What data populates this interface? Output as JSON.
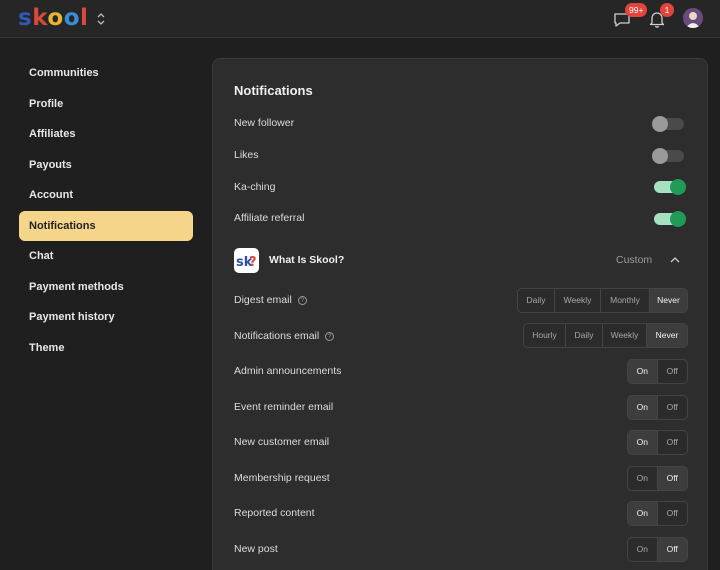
{
  "topbar": {
    "logo_parts": [
      "s",
      "k",
      "o",
      "o",
      "l"
    ],
    "chat_badge": "99+",
    "bell_badge": "1"
  },
  "sidebar": {
    "items": [
      {
        "label": "Communities"
      },
      {
        "label": "Profile"
      },
      {
        "label": "Affiliates"
      },
      {
        "label": "Payouts"
      },
      {
        "label": "Account"
      },
      {
        "label": "Notifications",
        "active": true
      },
      {
        "label": "Chat"
      },
      {
        "label": "Payment methods"
      },
      {
        "label": "Payment history"
      },
      {
        "label": "Theme"
      }
    ]
  },
  "notifications": {
    "title": "Notifications",
    "toggles": [
      {
        "label": "New follower",
        "state": "off"
      },
      {
        "label": "Likes",
        "state": "off"
      },
      {
        "label": "Ka-ching",
        "state": "on"
      },
      {
        "label": "Affiliate referral",
        "state": "on"
      }
    ],
    "group": {
      "icon_text": "sk?",
      "name": "What Is Skool?",
      "mode": "Custom"
    },
    "digest": {
      "label": "Digest email",
      "options": [
        "Daily",
        "Weekly",
        "Monthly",
        "Never"
      ],
      "selected": "Never"
    },
    "notif_email": {
      "label": "Notifications email",
      "options": [
        "Hourly",
        "Daily",
        "Weekly",
        "Never"
      ],
      "selected": "Never"
    },
    "on_label": "On",
    "off_label": "Off",
    "switches": [
      {
        "label": "Admin announcements",
        "selected": "On"
      },
      {
        "label": "Event reminder email",
        "selected": "On"
      },
      {
        "label": "New customer email",
        "selected": "On"
      },
      {
        "label": "Membership request",
        "selected": "Off"
      },
      {
        "label": "Reported content",
        "selected": "On"
      },
      {
        "label": "New post",
        "selected": "Off"
      }
    ]
  },
  "colors": {
    "accent_active_nav": "#f5d58a",
    "toggle_on": "#1e9c55",
    "badge": "#e2453c"
  }
}
